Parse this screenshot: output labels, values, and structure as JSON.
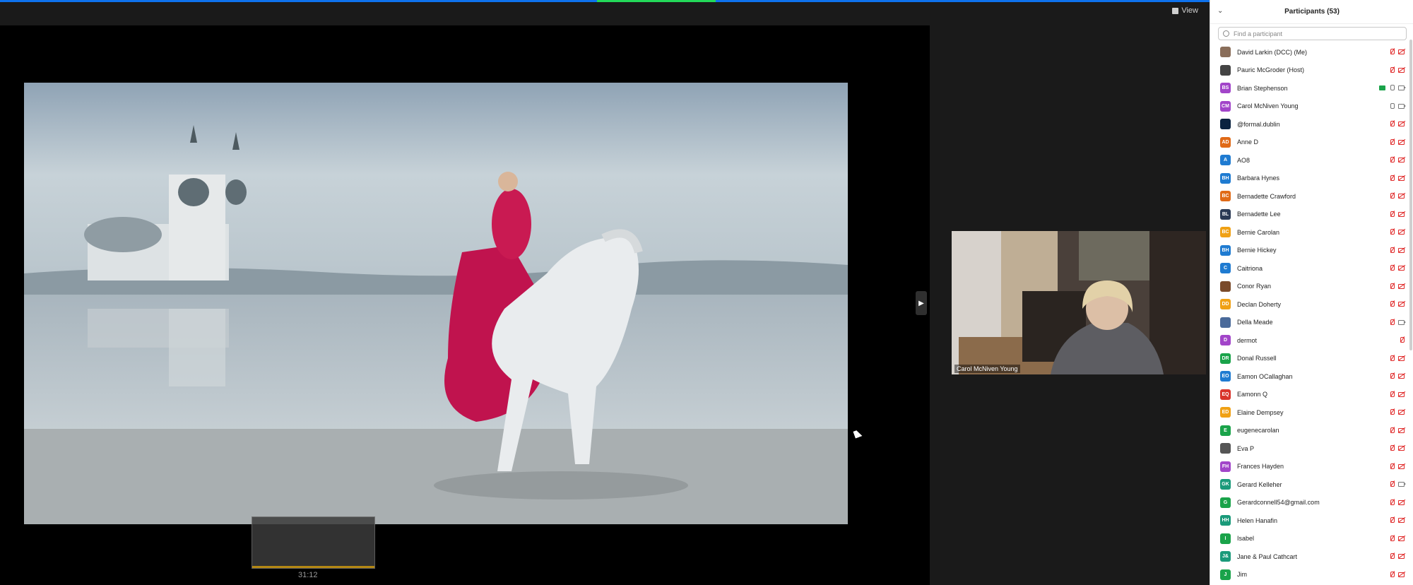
{
  "toolbar": {
    "view_label": "View"
  },
  "share": {
    "photo_alt": "Woman in red dress riding a white horse through shallow water with a church reflected behind",
    "thumbnail_timer": "31:12"
  },
  "video": {
    "name": "Carol McNiven Young"
  },
  "panel": {
    "title": "Participants (53)",
    "search_placeholder": "Find a participant",
    "participants": [
      {
        "name": "David Larkin (DCC) (Me)",
        "initials": "",
        "color": "#8a6e5a",
        "photo": true,
        "mic": "muted",
        "cam": "off"
      },
      {
        "name": "Pauric McGroder (Host)",
        "initials": "",
        "color": "#444",
        "photo": true,
        "mic": "muted",
        "cam": "off"
      },
      {
        "name": "Brian Stephenson",
        "initials": "BS",
        "color": "#a245c9",
        "mic": "on",
        "cam": "on",
        "sharing": true
      },
      {
        "name": "Carol McNiven Young",
        "initials": "CM",
        "color": "#a245c9",
        "mic": "on",
        "cam": "on"
      },
      {
        "name": "@formal.dublin",
        "initials": "",
        "color": "#0b2340",
        "photo": true,
        "mic": "muted",
        "cam": "off"
      },
      {
        "name": "Anne D",
        "initials": "AD",
        "color": "#e06a17",
        "mic": "muted",
        "cam": "off"
      },
      {
        "name": "AO8",
        "initials": "A",
        "color": "#1f7bd1",
        "mic": "muted",
        "cam": "off"
      },
      {
        "name": "Barbara Hynes",
        "initials": "BH",
        "color": "#1f7bd1",
        "mic": "muted",
        "cam": "off"
      },
      {
        "name": "Bernadette Crawford",
        "initials": "BC",
        "color": "#e06a17",
        "mic": "muted",
        "cam": "off"
      },
      {
        "name": "Bernadette Lee",
        "initials": "BL",
        "color": "#2b3a55",
        "mic": "muted",
        "cam": "off"
      },
      {
        "name": "Bernie Carolan",
        "initials": "BC",
        "color": "#f0a115",
        "mic": "muted",
        "cam": "off"
      },
      {
        "name": "Bernie Hickey",
        "initials": "BH",
        "color": "#1f7bd1",
        "mic": "muted",
        "cam": "off"
      },
      {
        "name": "Caitriona",
        "initials": "C",
        "color": "#1f7bd1",
        "mic": "muted",
        "cam": "off"
      },
      {
        "name": "Conor Ryan",
        "initials": "",
        "color": "#7a4a2a",
        "photo": true,
        "mic": "muted",
        "cam": "off"
      },
      {
        "name": "Declan Doherty",
        "initials": "DD",
        "color": "#f0a115",
        "mic": "muted",
        "cam": "off"
      },
      {
        "name": "Della Meade",
        "initials": "",
        "color": "#4a6a9a",
        "photo": true,
        "mic": "muted",
        "cam": "on"
      },
      {
        "name": "dermot",
        "initials": "D",
        "color": "#a245c9",
        "mic": "muted",
        "cam": "none"
      },
      {
        "name": "Donal Russell",
        "initials": "DR",
        "color": "#1aa34a",
        "mic": "muted",
        "cam": "off"
      },
      {
        "name": "Eamon OCallaghan",
        "initials": "EO",
        "color": "#1f7bd1",
        "mic": "muted",
        "cam": "off"
      },
      {
        "name": "Eamonn Q",
        "initials": "EQ",
        "color": "#d9342b",
        "mic": "muted",
        "cam": "off"
      },
      {
        "name": "Elaine Dempsey",
        "initials": "ED",
        "color": "#f0a115",
        "mic": "muted",
        "cam": "off"
      },
      {
        "name": "eugenecarolan",
        "initials": "E",
        "color": "#1aa34a",
        "mic": "muted",
        "cam": "off"
      },
      {
        "name": "Eva P",
        "initials": "",
        "color": "#555",
        "photo": true,
        "mic": "muted",
        "cam": "off"
      },
      {
        "name": "Frances Hayden",
        "initials": "FH",
        "color": "#a245c9",
        "mic": "muted",
        "cam": "off"
      },
      {
        "name": "Gerard Kelleher",
        "initials": "GK",
        "color": "#1a9a7a",
        "mic": "muted",
        "cam": "on"
      },
      {
        "name": "Gerardconnell54@gmail.com",
        "initials": "G",
        "color": "#1aa34a",
        "mic": "muted",
        "cam": "off"
      },
      {
        "name": "Helen Hanafin",
        "initials": "HH",
        "color": "#1a9a7a",
        "mic": "muted",
        "cam": "off"
      },
      {
        "name": "Isabel",
        "initials": "I",
        "color": "#1aa34a",
        "mic": "muted",
        "cam": "off"
      },
      {
        "name": "Jane & Paul Cathcart",
        "initials": "J&",
        "color": "#1a9a7a",
        "mic": "muted",
        "cam": "off"
      },
      {
        "name": "Jim",
        "initials": "J",
        "color": "#1aa34a",
        "mic": "muted",
        "cam": "off"
      }
    ]
  }
}
